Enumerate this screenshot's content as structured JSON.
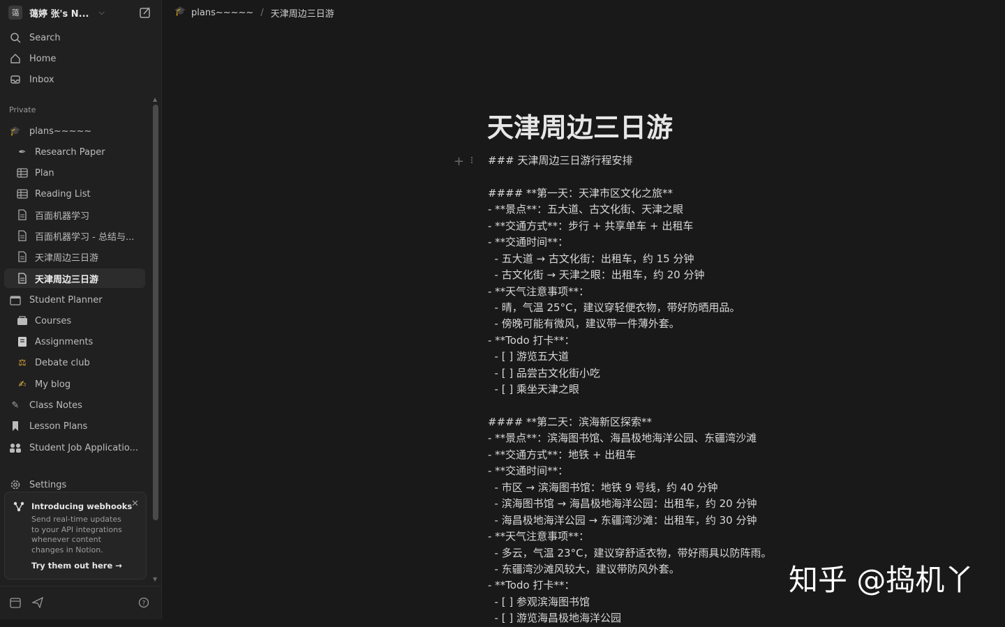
{
  "workspace": {
    "avatar": "蔼",
    "name": "蔼婷 张's N..."
  },
  "nav": [
    {
      "label": "Search",
      "icon": "search-icon"
    },
    {
      "label": "Home",
      "icon": "home-icon"
    },
    {
      "label": "Inbox",
      "icon": "inbox-icon"
    }
  ],
  "section_label": "Private",
  "tree": [
    {
      "label": "plans~~~~~",
      "icon": "graduation-cap-icon",
      "level": 0
    },
    {
      "label": "Research Paper",
      "icon": "pen-icon",
      "level": 1
    },
    {
      "label": "Plan",
      "icon": "table-icon",
      "level": 1
    },
    {
      "label": "Reading List",
      "icon": "table-icon",
      "level": 1
    },
    {
      "label": "百面机器学习",
      "icon": "page-icon",
      "level": 1
    },
    {
      "label": "百面机器学习 - 总结与...",
      "icon": "page-icon",
      "level": 1
    },
    {
      "label": "天津周边三日游",
      "icon": "page-icon",
      "level": 1
    },
    {
      "label": "天津周边三日游",
      "icon": "page-icon",
      "level": 1,
      "active": true
    },
    {
      "label": "Student Planner",
      "icon": "calendar-icon",
      "level": 0
    },
    {
      "label": "Courses",
      "icon": "books-icon",
      "level": 1
    },
    {
      "label": "Assignments",
      "icon": "notebook-icon",
      "level": 1
    },
    {
      "label": "Debate club",
      "icon": "scales-icon",
      "level": 1
    },
    {
      "label": "My blog",
      "icon": "writing-hand-icon",
      "level": 1
    },
    {
      "label": "Class Notes",
      "icon": "pencil-icon",
      "level": 0
    },
    {
      "label": "Lesson Plans",
      "icon": "bookmark-icon",
      "level": 0
    },
    {
      "label": "Student Job Applicatio...",
      "icon": "people-icon",
      "level": 0
    }
  ],
  "settings_label": "Settings",
  "webhook_card": {
    "title": "Introducing webhooks",
    "description": "Send real-time updates to your API integrations whenever content changes in Notion.",
    "link": "Try them out here"
  },
  "breadcrumb": {
    "parent": "plans~~~~~",
    "current": "天津周边三日游"
  },
  "page": {
    "title": "天津周边三日游",
    "lines": [
      "### 天津周边三日游行程安排",
      "",
      "#### **第一天：天津市区文化之旅**",
      "- **景点**：五大道、古文化街、天津之眼",
      "- **交通方式**：步行 + 共享单车 + 出租车",
      "- **交通时间**：",
      "  - 五大道 → 古文化街：出租车，约 15 分钟",
      "  - 古文化街 → 天津之眼：出租车，约 20 分钟",
      "- **天气注意事项**：",
      "  - 晴，气温 25°C，建议穿轻便衣物，带好防晒用品。",
      "  - 傍晚可能有微风，建议带一件薄外套。",
      "- **Todo 打卡**：",
      "  - [ ] 游览五大道",
      "  - [ ] 品尝古文化街小吃",
      "  - [ ] 乘坐天津之眼",
      "",
      "#### **第二天：滨海新区探索**",
      "- **景点**：滨海图书馆、海昌极地海洋公园、东疆湾沙滩",
      "- **交通方式**：地铁 + 出租车",
      "- **交通时间**：",
      "  - 市区 → 滨海图书馆：地铁 9 号线，约 40 分钟",
      "  - 滨海图书馆 → 海昌极地海洋公园：出租车，约 20 分钟",
      "  - 海昌极地海洋公园 → 东疆湾沙滩：出租车，约 30 分钟",
      "- **天气注意事项**：",
      "  - 多云，气温 23°C，建议穿舒适衣物，带好雨具以防阵雨。",
      "  - 东疆湾沙滩风较大，建议带防风外套。",
      "- **Todo 打卡**：",
      "  - [ ] 参观滨海图书馆",
      "  - [ ] 游览海昌极地海洋公园"
    ]
  },
  "watermark": "知乎 @捣机丫"
}
